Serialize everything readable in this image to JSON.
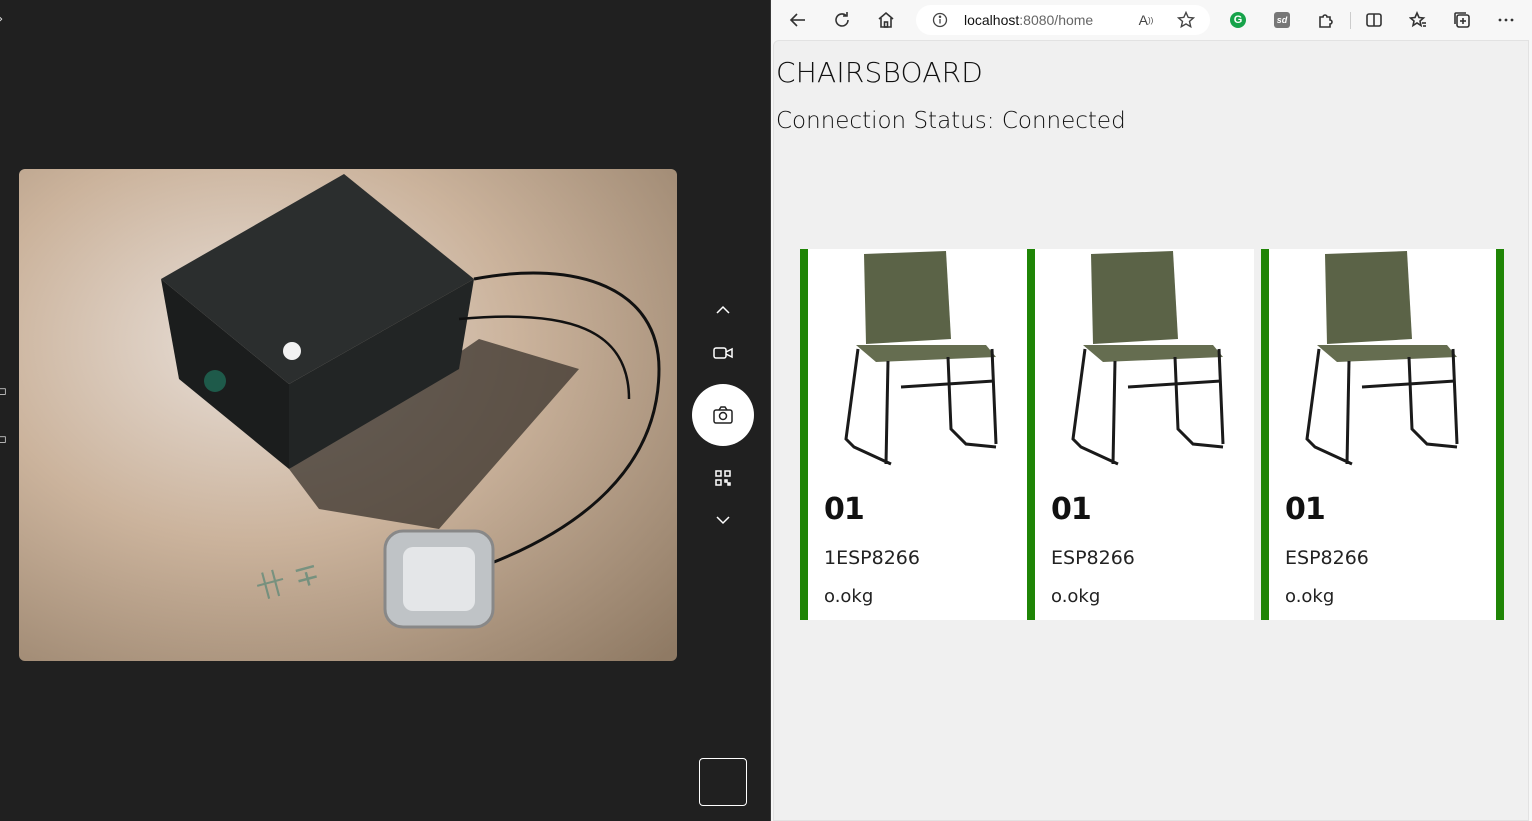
{
  "browser": {
    "url_host": "localhost",
    "url_path": ":8080/home",
    "read_aloud_label": "A̅"
  },
  "page": {
    "title": "CHAIRSBOARD",
    "status_label": "Connection Status:",
    "status_value": "Connected"
  },
  "cards": [
    {
      "number": "01",
      "device": "1ESP8266",
      "weight": "o.okg"
    },
    {
      "number": "01",
      "device": "ESP8266",
      "weight": "o.okg"
    },
    {
      "number": "01",
      "device": "ESP8266",
      "weight": "o.okg"
    }
  ],
  "colors": {
    "card_accent": "#1f8506",
    "camera_bg": "#202020",
    "page_bg": "#f0f0f0"
  },
  "icons": {
    "camera_controls": [
      "chevron-up-icon",
      "video-icon",
      "camera-icon",
      "qr-code-icon",
      "chevron-down-icon"
    ],
    "toolbar": [
      "back-icon",
      "refresh-icon",
      "home-icon",
      "info-icon",
      "read-aloud-icon",
      "favorite-star-icon",
      "grammarly-icon",
      "sd-extension-icon",
      "extensions-icon",
      "split-screen-icon",
      "favorites-icon",
      "collections-icon",
      "more-icon"
    ]
  }
}
